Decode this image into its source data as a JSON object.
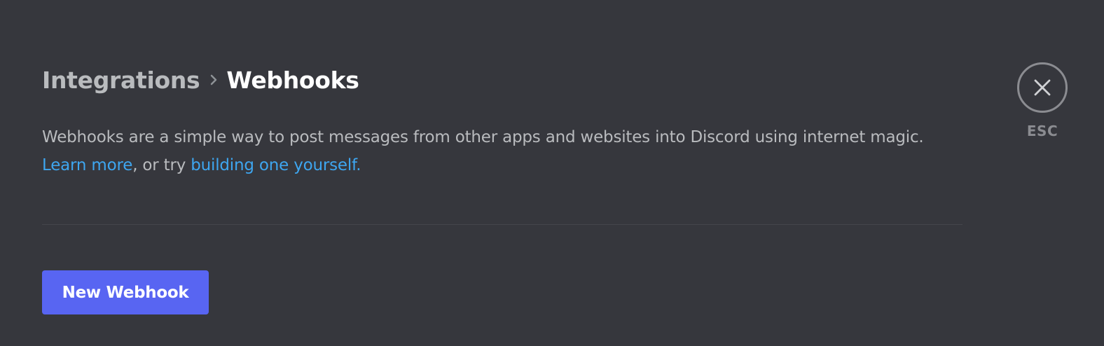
{
  "breadcrumb": {
    "parent": "Integrations",
    "separator_icon": "chevron-right-icon",
    "current": "Webhooks"
  },
  "description": {
    "text": "Webhooks are a simple way to post messages from other apps and websites into Discord using internet magic.",
    "learn_more_link": "Learn more",
    "middle_text": ", or try ",
    "build_link": "building one yourself."
  },
  "actions": {
    "new_webhook_label": "New Webhook"
  },
  "close": {
    "icon": "close-icon",
    "esc_label": "ESC"
  },
  "colors": {
    "background": "#36373d",
    "primary_button": "#5865f2",
    "link": "#3ea6f0",
    "muted_text": "#b9bbbe",
    "title_text": "#ffffff",
    "close_circle": "#8b8c91"
  }
}
